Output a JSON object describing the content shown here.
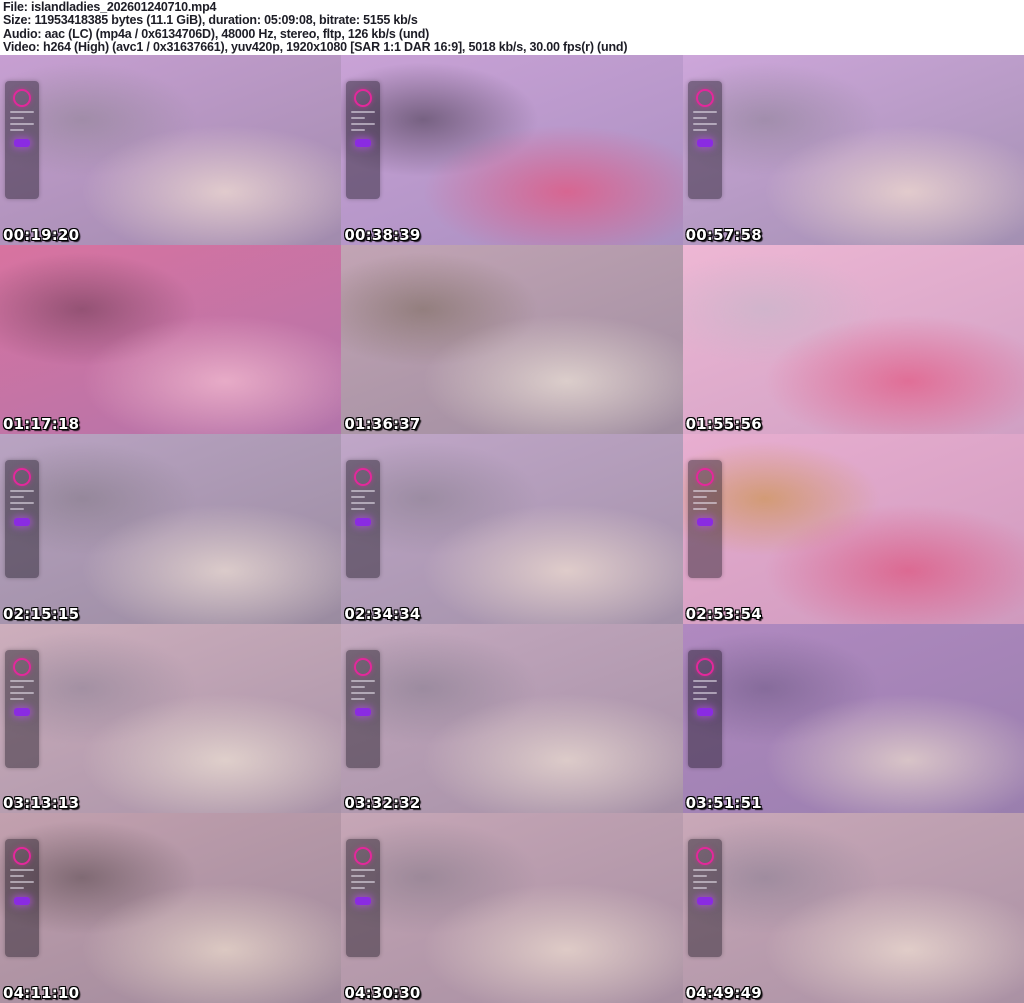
{
  "header": {
    "file_line": "File: islandladies_202601240710.mp4",
    "size_line": "Size: 11953418385 bytes (11.1 GiB), duration: 05:09:08, bitrate: 5155 kb/s",
    "audio_line": "Audio: aac (LC) (mp4a / 0x6134706D), 48000 Hz, stereo, fltp, 126 kb/s (und)",
    "video_line": "Video: h264 (High) (avc1 / 0x31637661), yuv420p, 1920x1080 [SAR 1:1 DAR 16:9], 5018 kb/s, 30.00 fps(r) (und)"
  },
  "colors": {
    "header_text": "#1d1d26",
    "timestamp_text": "#ffffff",
    "overlay_accent_pink": "#e3289b",
    "overlay_accent_purple": "#8a2be2"
  },
  "thumbnails": [
    {
      "timestamp": "00:19:20",
      "chat_overlay": true,
      "palette": [
        "#c79fd2",
        "#a18bad",
        "#eed9d2",
        "#8f8494"
      ]
    },
    {
      "timestamp": "00:38:39",
      "chat_overlay": true,
      "palette": [
        "#c9a2d6",
        "#a98fc0",
        "#e05a84",
        "#463a4e"
      ]
    },
    {
      "timestamp": "00:57:58",
      "chat_overlay": true,
      "palette": [
        "#cda6da",
        "#a390b2",
        "#efd8d0",
        "#8d8296"
      ]
    },
    {
      "timestamp": "01:17:18",
      "chat_overlay": false,
      "palette": [
        "#d873a0",
        "#b274aa",
        "#f2b9cf",
        "#6e3c55"
      ]
    },
    {
      "timestamp": "01:36:37",
      "chat_overlay": false,
      "palette": [
        "#c2a4b4",
        "#9f8da0",
        "#e8dcd4",
        "#7b6a5e"
      ]
    },
    {
      "timestamp": "01:55:56",
      "chat_overlay": false,
      "palette": [
        "#eeb7d4",
        "#d0a0c4",
        "#e2608a",
        "#c3b7c9"
      ]
    },
    {
      "timestamp": "02:15:15",
      "chat_overlay": true,
      "palette": [
        "#b9a3c2",
        "#9a8ba0",
        "#e9d9d2",
        "#847a88"
      ]
    },
    {
      "timestamp": "02:34:34",
      "chat_overlay": true,
      "palette": [
        "#c0a6c8",
        "#a291a8",
        "#ecd9d0",
        "#8a7f90"
      ]
    },
    {
      "timestamp": "02:53:54",
      "chat_overlay": true,
      "palette": [
        "#e8aed0",
        "#cf9abe",
        "#dd5c86",
        "#c9923e"
      ]
    },
    {
      "timestamp": "03:13:13",
      "chat_overlay": true,
      "palette": [
        "#cdaebc",
        "#a993a8",
        "#eadcd2",
        "#8f8296"
      ]
    },
    {
      "timestamp": "03:32:32",
      "chat_overlay": true,
      "palette": [
        "#c4a8be",
        "#a590a6",
        "#e8d8d0",
        "#887d90"
      ]
    },
    {
      "timestamp": "03:51:51",
      "chat_overlay": true,
      "palette": [
        "#b089c0",
        "#9a7fae",
        "#e6d4cc",
        "#6f5a86"
      ]
    },
    {
      "timestamp": "04:11:10",
      "chat_overlay": true,
      "palette": [
        "#c2a0ae",
        "#a08a9c",
        "#e8d6ca",
        "#5a4a50"
      ]
    },
    {
      "timestamp": "04:30:30",
      "chat_overlay": true,
      "palette": [
        "#c6a6b6",
        "#a78fa2",
        "#ead8ce",
        "#877a8a"
      ]
    },
    {
      "timestamp": "04:49:49",
      "chat_overlay": true,
      "palette": [
        "#c9a8b8",
        "#aa91a4",
        "#ecdad0",
        "#8a7e92"
      ]
    }
  ]
}
